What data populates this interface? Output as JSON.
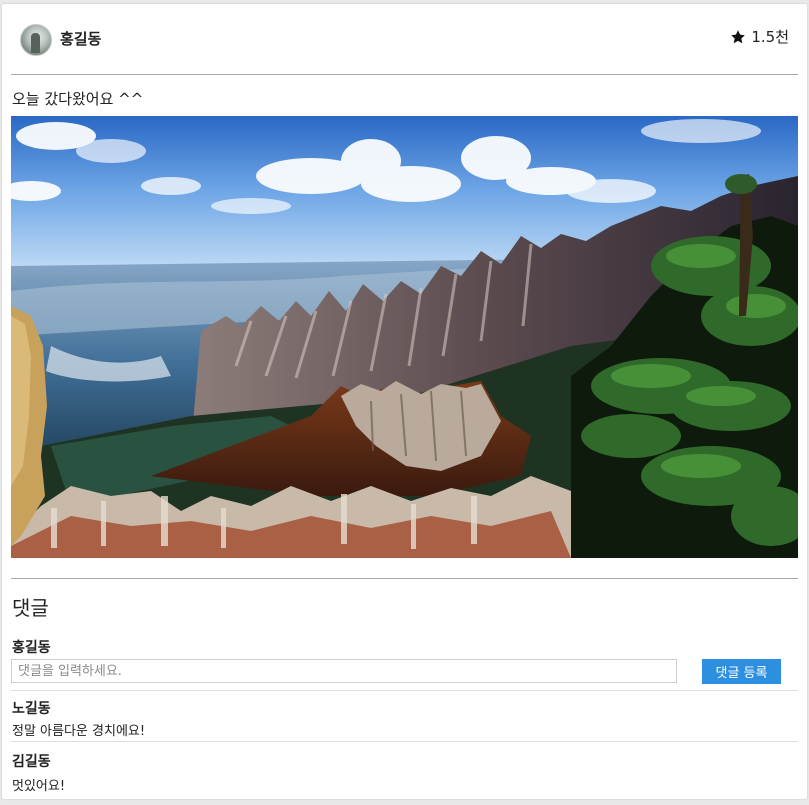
{
  "post": {
    "author": "홍길동",
    "rating": "1.5천",
    "caption": "오늘 갔다왔어요 ^^"
  },
  "comments_section": {
    "title": "댓글",
    "current_user": "홍길동",
    "input_placeholder": "댓글을 입력하세요.",
    "submit_label": "댓글 등록",
    "items": [
      {
        "author": "노길동",
        "text": "정말 아름다운 경치에요!"
      },
      {
        "author": "김길동",
        "text": "멋있어요!"
      }
    ]
  },
  "colors": {
    "accent": "#2d8fe0",
    "divider": "#a8a8a8"
  },
  "icons": {
    "rating": "star-icon",
    "avatar": "user-avatar"
  }
}
